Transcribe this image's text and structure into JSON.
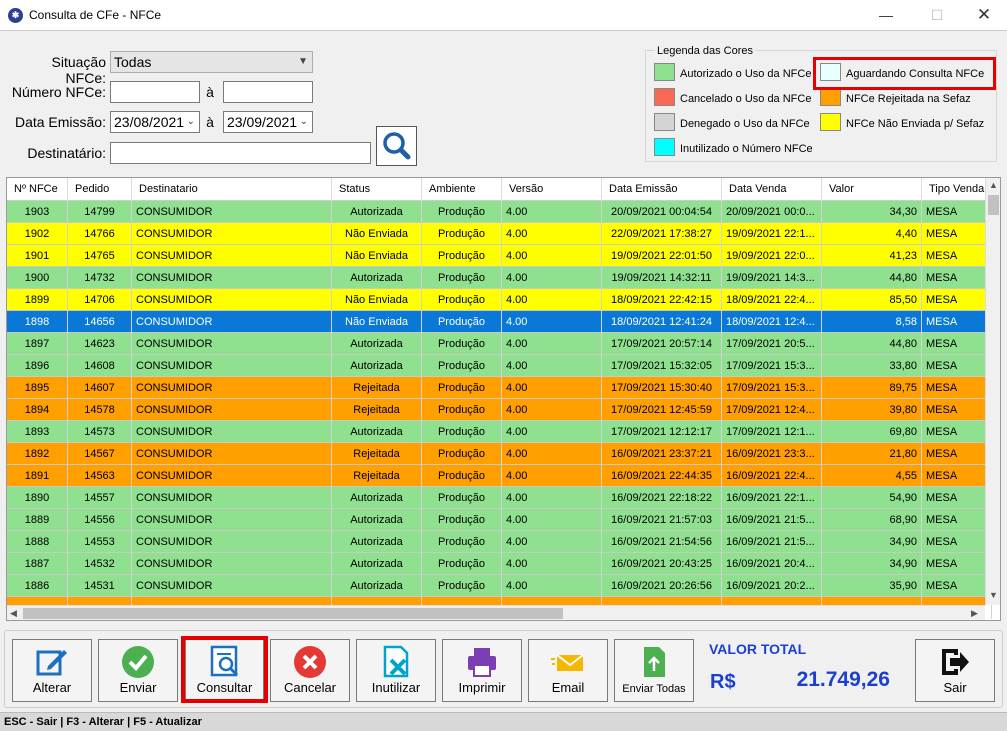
{
  "window": {
    "title": "Consulta de CFe - NFCe",
    "close": "✕",
    "minimize": "—",
    "maximize": "☐"
  },
  "filters": {
    "situacao_label": "Situação NFCe:",
    "situacao_value": "Todas",
    "numero_label": "Número NFCe:",
    "numero_from": "",
    "numero_sep": "à",
    "numero_to": "",
    "data_label": "Data Emissão:",
    "data_from": "23/08/2021",
    "data_sep": "à",
    "data_to": "23/09/2021",
    "dest_label": "Destinatário:",
    "dest_value": ""
  },
  "legend": {
    "title": "Legenda das Cores",
    "items": [
      {
        "label": "Autorizado o Uso da NFCe",
        "color": "#8fe08f"
      },
      {
        "label": "Aguardando Consulta NFCe",
        "color": "#e8ffff"
      },
      {
        "label": "Cancelado o Uso da NFCe",
        "color": "#f86a56"
      },
      {
        "label": "NFCe Rejeitada na Sefaz",
        "color": "#ff9f00"
      },
      {
        "label": "Denegado o Uso da NFCe",
        "color": "#d4d4d4"
      },
      {
        "label": "NFCe Não Enviada p/ Sefaz",
        "color": "#ffff00"
      },
      {
        "label": "Inutilizado o Número NFCe",
        "color": "#00ffff"
      }
    ]
  },
  "grid": {
    "columns": [
      "Nº NFCe",
      "Pedido",
      "Destinatario",
      "Status",
      "Ambiente",
      "Versão",
      "Data Emissão",
      "Data Venda",
      "Valor",
      "Tipo Venda"
    ],
    "rows": [
      {
        "nfce": "1903",
        "pedido": "14799",
        "dest": "CONSUMIDOR",
        "status": "Autorizada",
        "ambiente": "Produção",
        "versao": "4.00",
        "emissao": "20/09/2021 00:04:54",
        "venda": "20/09/2021 00:0...",
        "valor": "34,30",
        "tipo": "MESA",
        "color": "#8fe08f"
      },
      {
        "nfce": "1902",
        "pedido": "14766",
        "dest": "CONSUMIDOR",
        "status": "Não Enviada",
        "ambiente": "Produção",
        "versao": "4.00",
        "emissao": "22/09/2021 17:38:27",
        "venda": "19/09/2021 22:1...",
        "valor": "4,40",
        "tipo": "MESA",
        "color": "#ffff00"
      },
      {
        "nfce": "1901",
        "pedido": "14765",
        "dest": "CONSUMIDOR",
        "status": "Não Enviada",
        "ambiente": "Produção",
        "versao": "4.00",
        "emissao": "19/09/2021 22:01:50",
        "venda": "19/09/2021 22:0...",
        "valor": "41,23",
        "tipo": "MESA",
        "color": "#ffff00"
      },
      {
        "nfce": "1900",
        "pedido": "14732",
        "dest": "CONSUMIDOR",
        "status": "Autorizada",
        "ambiente": "Produção",
        "versao": "4.00",
        "emissao": "19/09/2021 14:32:11",
        "venda": "19/09/2021 14:3...",
        "valor": "44,80",
        "tipo": "MESA",
        "color": "#8fe08f"
      },
      {
        "nfce": "1899",
        "pedido": "14706",
        "dest": "CONSUMIDOR",
        "status": "Não Enviada",
        "ambiente": "Produção",
        "versao": "4.00",
        "emissao": "18/09/2021 22:42:15",
        "venda": "18/09/2021 22:4...",
        "valor": "85,50",
        "tipo": "MESA",
        "color": "#ffff00"
      },
      {
        "nfce": "1898",
        "pedido": "14656",
        "dest": "CONSUMIDOR",
        "status": "Não Enviada",
        "ambiente": "Produção",
        "versao": "4.00",
        "emissao": "18/09/2021 12:41:24",
        "venda": "18/09/2021 12:4...",
        "valor": "8,58",
        "tipo": "MESA",
        "color": "#0a78d7",
        "selected": true
      },
      {
        "nfce": "1897",
        "pedido": "14623",
        "dest": "CONSUMIDOR",
        "status": "Autorizada",
        "ambiente": "Produção",
        "versao": "4.00",
        "emissao": "17/09/2021 20:57:14",
        "venda": "17/09/2021 20:5...",
        "valor": "44,80",
        "tipo": "MESA",
        "color": "#8fe08f"
      },
      {
        "nfce": "1896",
        "pedido": "14608",
        "dest": "CONSUMIDOR",
        "status": "Autorizada",
        "ambiente": "Produção",
        "versao": "4.00",
        "emissao": "17/09/2021 15:32:05",
        "venda": "17/09/2021 15:3...",
        "valor": "33,80",
        "tipo": "MESA",
        "color": "#8fe08f"
      },
      {
        "nfce": "1895",
        "pedido": "14607",
        "dest": "CONSUMIDOR",
        "status": "Rejeitada",
        "ambiente": "Produção",
        "versao": "4.00",
        "emissao": "17/09/2021 15:30:40",
        "venda": "17/09/2021 15:3...",
        "valor": "89,75",
        "tipo": "MESA",
        "color": "#ff9f00"
      },
      {
        "nfce": "1894",
        "pedido": "14578",
        "dest": "CONSUMIDOR",
        "status": "Rejeitada",
        "ambiente": "Produção",
        "versao": "4.00",
        "emissao": "17/09/2021 12:45:59",
        "venda": "17/09/2021 12:4...",
        "valor": "39,80",
        "tipo": "MESA",
        "color": "#ff9f00"
      },
      {
        "nfce": "1893",
        "pedido": "14573",
        "dest": "CONSUMIDOR",
        "status": "Autorizada",
        "ambiente": "Produção",
        "versao": "4.00",
        "emissao": "17/09/2021 12:12:17",
        "venda": "17/09/2021 12:1...",
        "valor": "69,80",
        "tipo": "MESA",
        "color": "#8fe08f"
      },
      {
        "nfce": "1892",
        "pedido": "14567",
        "dest": "CONSUMIDOR",
        "status": "Rejeitada",
        "ambiente": "Produção",
        "versao": "4.00",
        "emissao": "16/09/2021 23:37:21",
        "venda": "16/09/2021 23:3...",
        "valor": "21,80",
        "tipo": "MESA",
        "color": "#ff9f00"
      },
      {
        "nfce": "1891",
        "pedido": "14563",
        "dest": "CONSUMIDOR",
        "status": "Rejeitada",
        "ambiente": "Produção",
        "versao": "4.00",
        "emissao": "16/09/2021 22:44:35",
        "venda": "16/09/2021 22:4...",
        "valor": "4,55",
        "tipo": "MESA",
        "color": "#ff9f00"
      },
      {
        "nfce": "1890",
        "pedido": "14557",
        "dest": "CONSUMIDOR",
        "status": "Autorizada",
        "ambiente": "Produção",
        "versao": "4.00",
        "emissao": "16/09/2021 22:18:22",
        "venda": "16/09/2021 22:1...",
        "valor": "54,90",
        "tipo": "MESA",
        "color": "#8fe08f"
      },
      {
        "nfce": "1889",
        "pedido": "14556",
        "dest": "CONSUMIDOR",
        "status": "Autorizada",
        "ambiente": "Produção",
        "versao": "4.00",
        "emissao": "16/09/2021 21:57:03",
        "venda": "16/09/2021 21:5...",
        "valor": "68,90",
        "tipo": "MESA",
        "color": "#8fe08f"
      },
      {
        "nfce": "1888",
        "pedido": "14553",
        "dest": "CONSUMIDOR",
        "status": "Autorizada",
        "ambiente": "Produção",
        "versao": "4.00",
        "emissao": "16/09/2021 21:54:56",
        "venda": "16/09/2021 21:5...",
        "valor": "34,90",
        "tipo": "MESA",
        "color": "#8fe08f"
      },
      {
        "nfce": "1887",
        "pedido": "14532",
        "dest": "CONSUMIDOR",
        "status": "Autorizada",
        "ambiente": "Produção",
        "versao": "4.00",
        "emissao": "16/09/2021 20:43:25",
        "venda": "16/09/2021 20:4...",
        "valor": "34,90",
        "tipo": "MESA",
        "color": "#8fe08f"
      },
      {
        "nfce": "1886",
        "pedido": "14531",
        "dest": "CONSUMIDOR",
        "status": "Autorizada",
        "ambiente": "Produção",
        "versao": "4.00",
        "emissao": "16/09/2021 20:26:56",
        "venda": "16/09/2021 20:2...",
        "valor": "35,90",
        "tipo": "MESA",
        "color": "#8fe08f"
      },
      {
        "nfce": "",
        "pedido": "",
        "dest": "",
        "status": "",
        "ambiente": "",
        "versao": "",
        "emissao": "",
        "venda": "",
        "valor": "",
        "tipo": "",
        "color": "#ff9f00"
      }
    ]
  },
  "toolbar": {
    "alterar": "Alterar",
    "enviar": "Enviar",
    "consultar": "Consultar",
    "cancelar": "Cancelar",
    "inutilizar": "Inutilizar",
    "imprimir": "Imprimir",
    "email": "Email",
    "enviar_todas": "Enviar Todas",
    "sair": "Sair"
  },
  "total": {
    "label": "VALOR TOTAL",
    "currency": "R$",
    "value": "21.749,26"
  },
  "statusbar": "ESC - Sair | F3 - Alterar  |  F5 - Atualizar"
}
